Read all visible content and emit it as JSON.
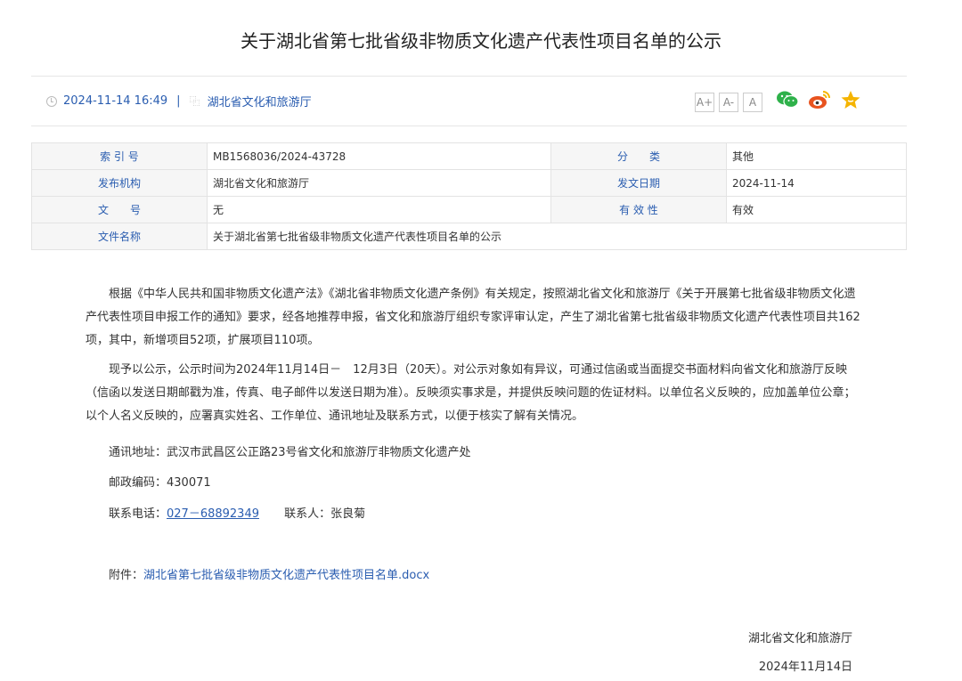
{
  "title": "关于湖北省第七批省级非物质文化遗产代表性项目名单的公示",
  "meta": {
    "datetime": "2024-11-14 16:49",
    "separator": "|",
    "org": "湖北省文化和旅游厅",
    "icons": [
      "clock-icon",
      "org-icon"
    ]
  },
  "tools": {
    "font_large": "A+",
    "font_small": "A-",
    "font_default": "A",
    "share_icons": [
      "wechat-icon",
      "weibo-icon",
      "star-icon"
    ],
    "colors": {
      "wechat": "#2eb14a",
      "weibo": "#e8531f",
      "star": "#f5b400"
    }
  },
  "info_table": {
    "rows": [
      [
        {
          "label": "索 引 号",
          "value": "MB1568036/2024-43728"
        },
        {
          "label": "分　　类",
          "value": "其他"
        }
      ],
      [
        {
          "label": "发布机构",
          "value": "湖北省文化和旅游厅"
        },
        {
          "label": "发文日期",
          "value": "2024-11-14"
        }
      ],
      [
        {
          "label": "文　　号",
          "value": "无"
        },
        {
          "label": "有 效 性",
          "value": "有效"
        }
      ]
    ],
    "file_name_label": "文件名称",
    "file_name_value": "关于湖北省第七批省级非物质文化遗产代表性项目名单的公示"
  },
  "body": {
    "para1": "根据《中华人民共和国非物质文化遗产法》《湖北省非物质文化遗产条例》有关规定，按照湖北省文化和旅游厅《关于开展第七批省级非物质文化遗产代表性项目申报工作的通知》要求，经各地推荐申报，省文化和旅游厅组织专家评审认定，产生了湖北省第七批省级非物质文化遗产代表性项目共162项，其中，新增项目52项，扩展项目110项。",
    "para2": "现予以公示，公示时间为2024年11月14日－　12月3日（20天）。对公示对象如有异议，可通过信函或当面提交书面材料向省文化和旅游厅反映（信函以发送日期邮戳为准，传真、电子邮件以发送日期为准）。反映须实事求是，并提供反映问题的佐证材料。以单位名义反映的，应加盖单位公章；以个人名义反映的，应署真实姓名、工作单位、通讯地址及联系方式，以便于核实了解有关情况。",
    "address": "通讯地址：武汉市武昌区公正路23号省文化和旅游厅非物质文化遗产处",
    "postcode": "邮政编码：430071",
    "phone_label": "联系电话：",
    "phone": "027－68892349",
    "contact": "联系人：张良菊",
    "attachment_label": "附件：",
    "attachment": "湖北省第七批省级非物质文化遗产代表性项目名单.docx"
  },
  "signature": {
    "org": "湖北省文化和旅游厅",
    "date": "2024年11月14日"
  }
}
